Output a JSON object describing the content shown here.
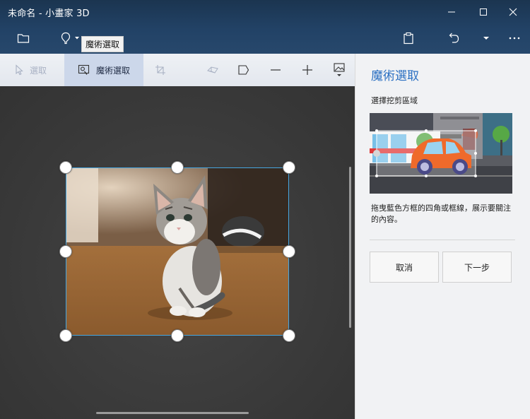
{
  "window": {
    "title": "未命名 - 小畫家 3D"
  },
  "tooltip": {
    "text": "魔術選取"
  },
  "toolbar": {
    "select_label": "選取",
    "magic_select_label": "魔術選取"
  },
  "panel": {
    "title": "魔術選取",
    "subtitle": "選擇挖剪區域",
    "description": "拖曳藍色方框的四角或框線，展示要關注的內容。",
    "cancel_label": "取消",
    "next_label": "下一步"
  },
  "colors": {
    "accent": "#2b70c2",
    "titlebar": "#224266",
    "selection_border": "#2f8bc6"
  }
}
